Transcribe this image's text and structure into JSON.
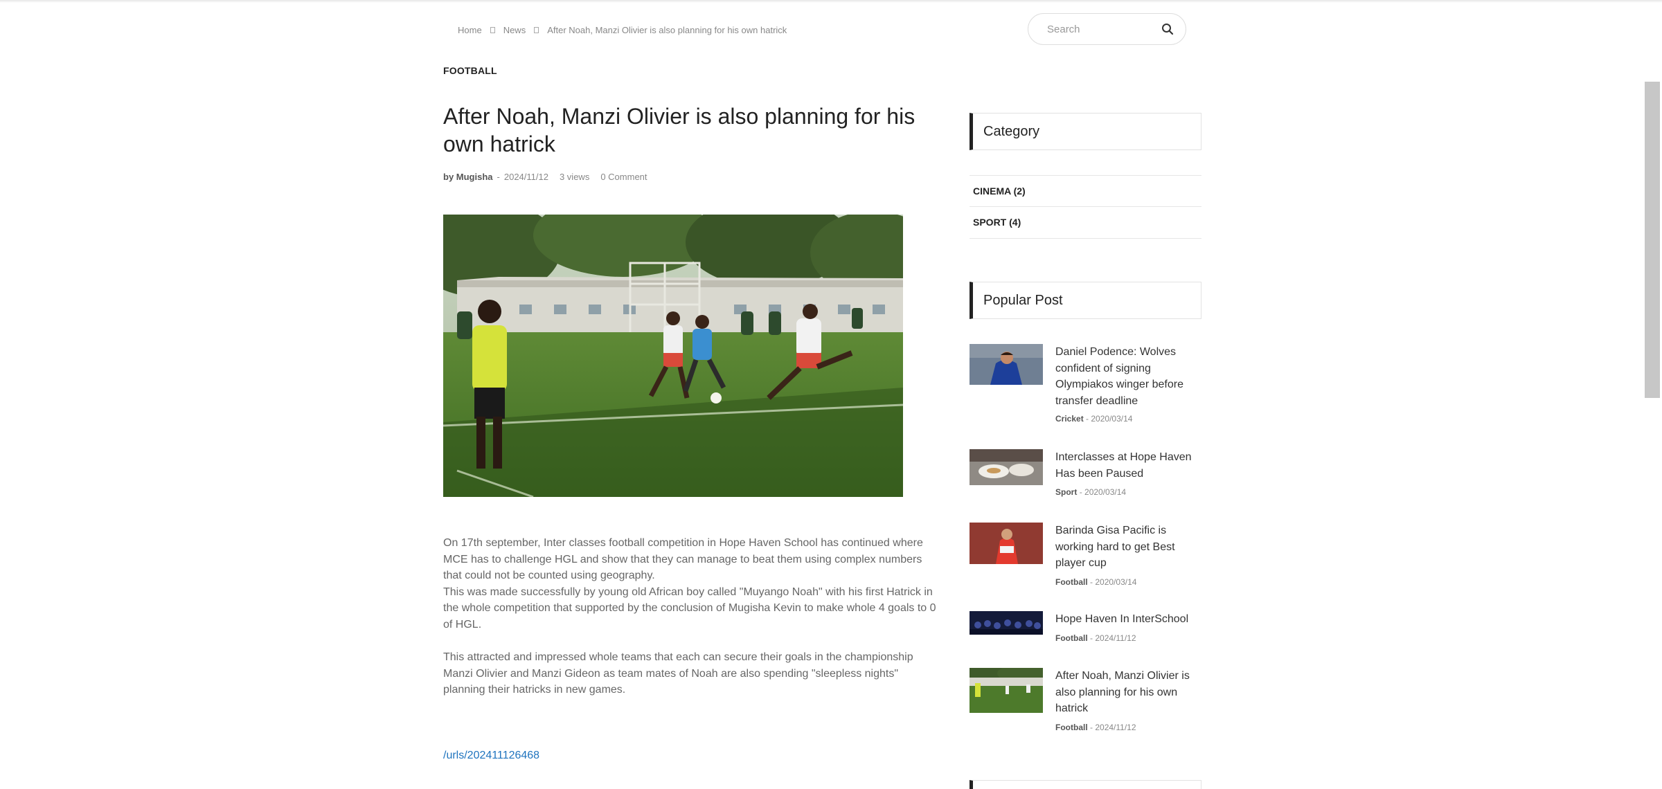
{
  "breadcrumb": {
    "home": "Home",
    "news": "News",
    "current": "After Noah, Manzi Olivier is also planning for his own hatrick"
  },
  "search": {
    "placeholder": "Search"
  },
  "article": {
    "category": "FOOTBALL",
    "title": "After Noah, Manzi Olivier is also planning for his own hatrick",
    "author": "by Mugisha",
    "date": "2024/11/12",
    "views": "3 views",
    "comments": "0 Comment",
    "paragraphs": [
      "On 17th september, Inter classes football competition in Hope Haven School has continued where MCE has to challenge HGL and show that they can manage to beat them using complex numbers that could not be counted using geography.",
      "This was made successfully by young old African boy called \"Muyango Noah\" with his first Hatrick in the whole competition that supported by the conclusion of Mugisha Kevin to make whole 4 goals to 0 of HGL.",
      "This attracted and impressed whole teams that each can secure their goals in the championship Manzi Olivier and Manzi Gideon as team mates of Noah are also spending \"sleepless nights\" planning their hatricks in new games."
    ],
    "link": "/urls/202411126468"
  },
  "sidebar": {
    "category_heading": "Category",
    "categories": [
      {
        "label": "CINEMA (2)"
      },
      {
        "label": "SPORT (4)"
      }
    ],
    "popular_heading": "Popular Post",
    "posts": [
      {
        "title": "Daniel Podence: Wolves confident of signing Olympiakos winger before transfer deadline",
        "category": "Cricket",
        "date": "2020/03/14"
      },
      {
        "title": "Interclasses at Hope Haven Has been Paused",
        "category": "Sport",
        "date": "2020/03/14"
      },
      {
        "title": "Barinda Gisa Pacific is working hard to get Best player cup",
        "category": "Football",
        "date": "2020/03/14"
      },
      {
        "title": "Hope Haven In InterSchool",
        "category": "Football",
        "date": "2024/11/12"
      },
      {
        "title": "After Noah, Manzi Olivier is also planning for his own hatrick",
        "category": "Football",
        "date": "2024/11/12"
      }
    ]
  },
  "colors": {
    "accent_link": "#1e73be",
    "widget_bar": "#222222"
  },
  "icons": {
    "search": "search-icon",
    "breadcrumb_separator": "square-icon"
  }
}
